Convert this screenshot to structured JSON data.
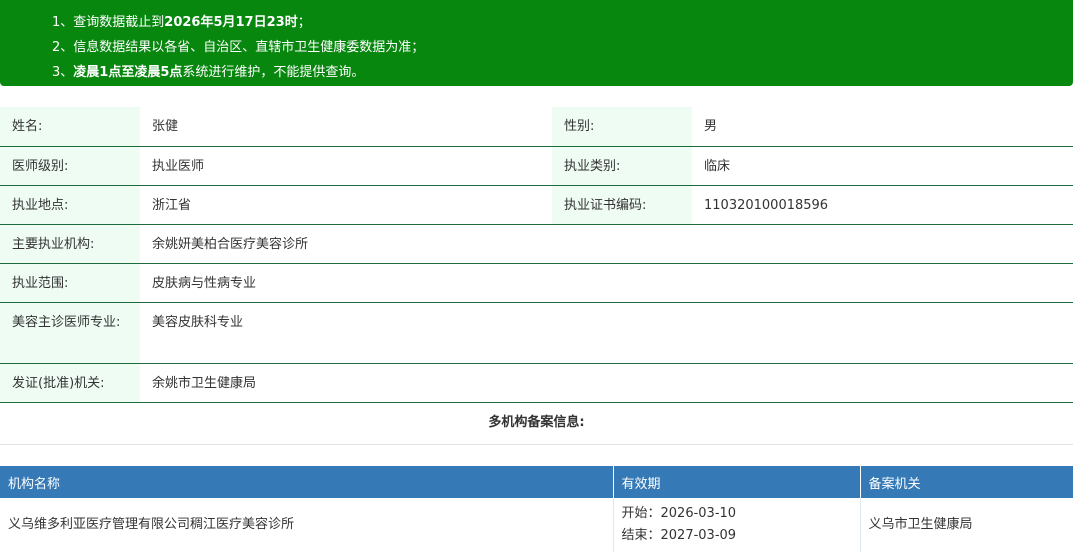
{
  "notice": {
    "line1_prefix": "1、查询数据截止到",
    "line1_bold": "2026年5月17日23时",
    "line1_suffix": "；",
    "line2": "2、信息数据结果以各省、自治区、直辖市卫生健康委数据为准；",
    "line3_prefix": "3、",
    "line3_bold": "凌晨1点至凌晨5点",
    "line3_suffix": "系统进行维护，不能提供查询。"
  },
  "info": {
    "name_label": "姓名:",
    "name": "张健",
    "gender_label": "性别:",
    "gender": "男",
    "level_label": "医师级别:",
    "level": "执业医师",
    "category_label": "执业类别:",
    "category": "临床",
    "location_label": "执业地点:",
    "location": "浙江省",
    "cert_label": "执业证书编码:",
    "cert": "110320100018596",
    "institution_label": "主要执业机构:",
    "institution": "余姚妍美柏合医疗美容诊所",
    "scope_label": "执业范围:",
    "scope": "皮肤病与性病专业",
    "cosmetic_label": "美容主诊医师专业:",
    "cosmetic": "美容皮肤科专业",
    "issuer_label": "发证(批准)机关:",
    "issuer": "余姚市卫生健康局"
  },
  "multi": {
    "title": "多机构备案信息:",
    "headers": {
      "org": "机构名称",
      "period": "有效期",
      "authority": "备案机关"
    },
    "rows": [
      {
        "org": "义乌维多利亚医疗管理有限公司稠江医疗美容诊所",
        "start": "开始：2026-03-10",
        "end": "结束：2027-03-09",
        "authority": "义乌市卫生健康局"
      }
    ]
  }
}
